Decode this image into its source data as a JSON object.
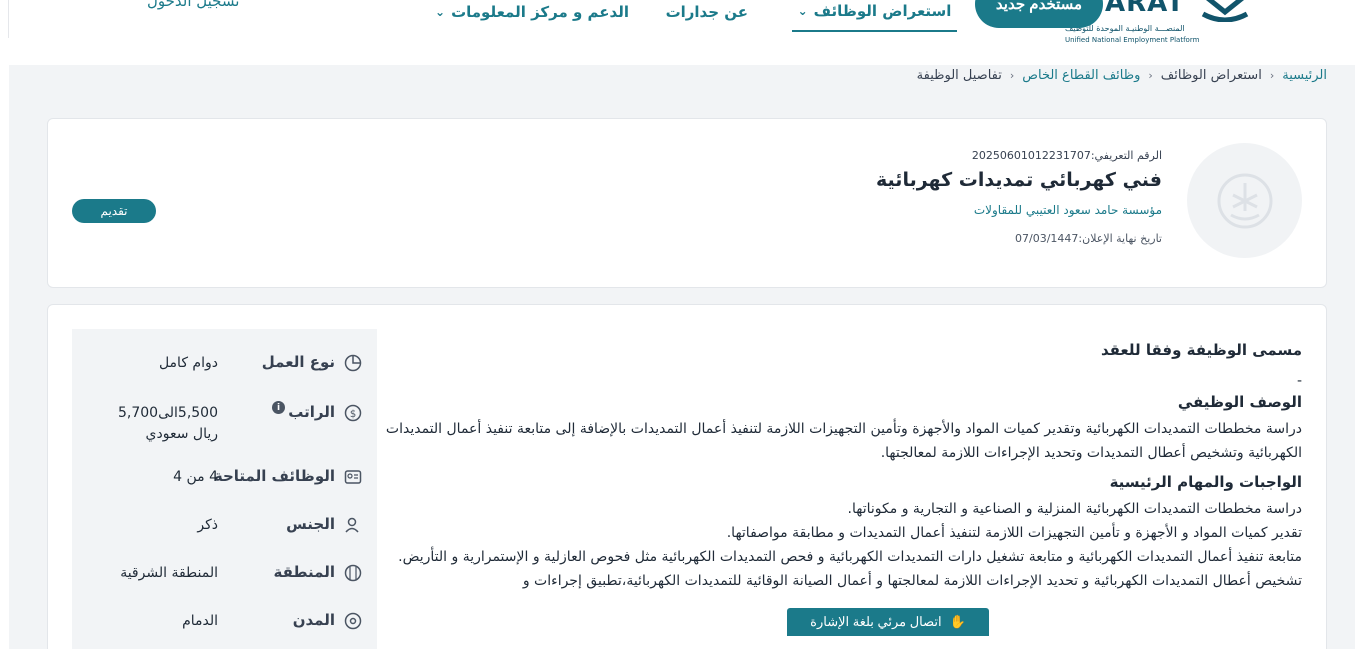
{
  "header": {
    "logo_text": "JADARAT",
    "logo_sub_ar": "المنصـــة الوطنيـة الموحدة للتوظيف",
    "logo_sub_en": "Unified National Employment Platform",
    "nav": {
      "jobs": "استعراض الوظائف",
      "about": "عن جدارات",
      "support": "الدعم و مركز المعلومات"
    },
    "register": "مستخدم جديد",
    "login": "تسجيل الدخول"
  },
  "breadcrumb": {
    "home": "الرئيسية",
    "jobs": "استعراض الوظائف",
    "private": "وظائف القطاع الخاص",
    "current": "تفاصيل الوظيفة"
  },
  "job": {
    "ref": "الرقم التعريفي:20250601012231707",
    "title": "فني كهربائي تمديدات كهربائية",
    "company": "مؤسسة حامد سعود العتيبي للمقاولات",
    "deadline": "تاريخ نهاية الإعلان:07/03/1447",
    "apply": "تقديم"
  },
  "info": [
    {
      "label": "نوع العمل",
      "value": "دوام كامل",
      "icon": "pie-chart-icon"
    },
    {
      "label": "الراتب",
      "value": "5,500الى5,700 ريال سعودي",
      "icon": "money-icon"
    },
    {
      "label": "الوظائف المتاحة",
      "value": "4 من 4",
      "icon": "id-card-icon"
    },
    {
      "label": "الجنس",
      "value": "ذكر",
      "icon": "user-icon"
    },
    {
      "label": "المنطقة",
      "value": "المنطقة الشرقية",
      "icon": "map-icon"
    },
    {
      "label": "المدن",
      "value": "الدمام",
      "icon": "location-pin-icon"
    }
  ],
  "content": {
    "contract_title": "مسمى الوظيفة وفقا للعقد",
    "contract_value": "-",
    "desc_title": "الوصف الوظيفي",
    "desc_text": "دراسة مخططات التمديدات الكهربائية وتقدير كميات المواد والأجهزة وتأمين التجهيزات اللازمة لتنفيذ أعمال التمديدات بالإضافة إلى متابعة تنفيذ أعمال التمديدات الكهربائية وتشخيص أعطال التمديدات وتحديد الإجراءات اللازمة لمعالجتها.",
    "duties_title": "الواجبات والمهام الرئيسية",
    "duties": [
      "دراسة مخططات التمديدات الكهربائية المنزلية و الصناعية و التجارية و مكوناتها.",
      "تقدير كميات المواد و الأجهزة و تأمين التجهيزات اللازمة لتنفيذ أعمال التمديدات و مطابقة مواصفاتها.",
      "متابعة تنفيذ أعمال التمديدات الكهربائية و متابعة تشغيل دارات التمديدات الكهربائية و فحص التمديدات الكهربائية مثل فحوص العازلية و الإستمرارية و التأريض.",
      "تشخيص أعطال التمديدات الكهربائية و تحديد الإجراءات اللازمة لمعالجتها و أعمال الصيانة الوقائية للتمديدات الكهربائية،تطبيق إجراءات و"
    ]
  },
  "sign_language": "اتصال مرئي بلغة الإشارة",
  "colors": {
    "accent": "#1b7a8a",
    "background": "#f2f4f6"
  }
}
